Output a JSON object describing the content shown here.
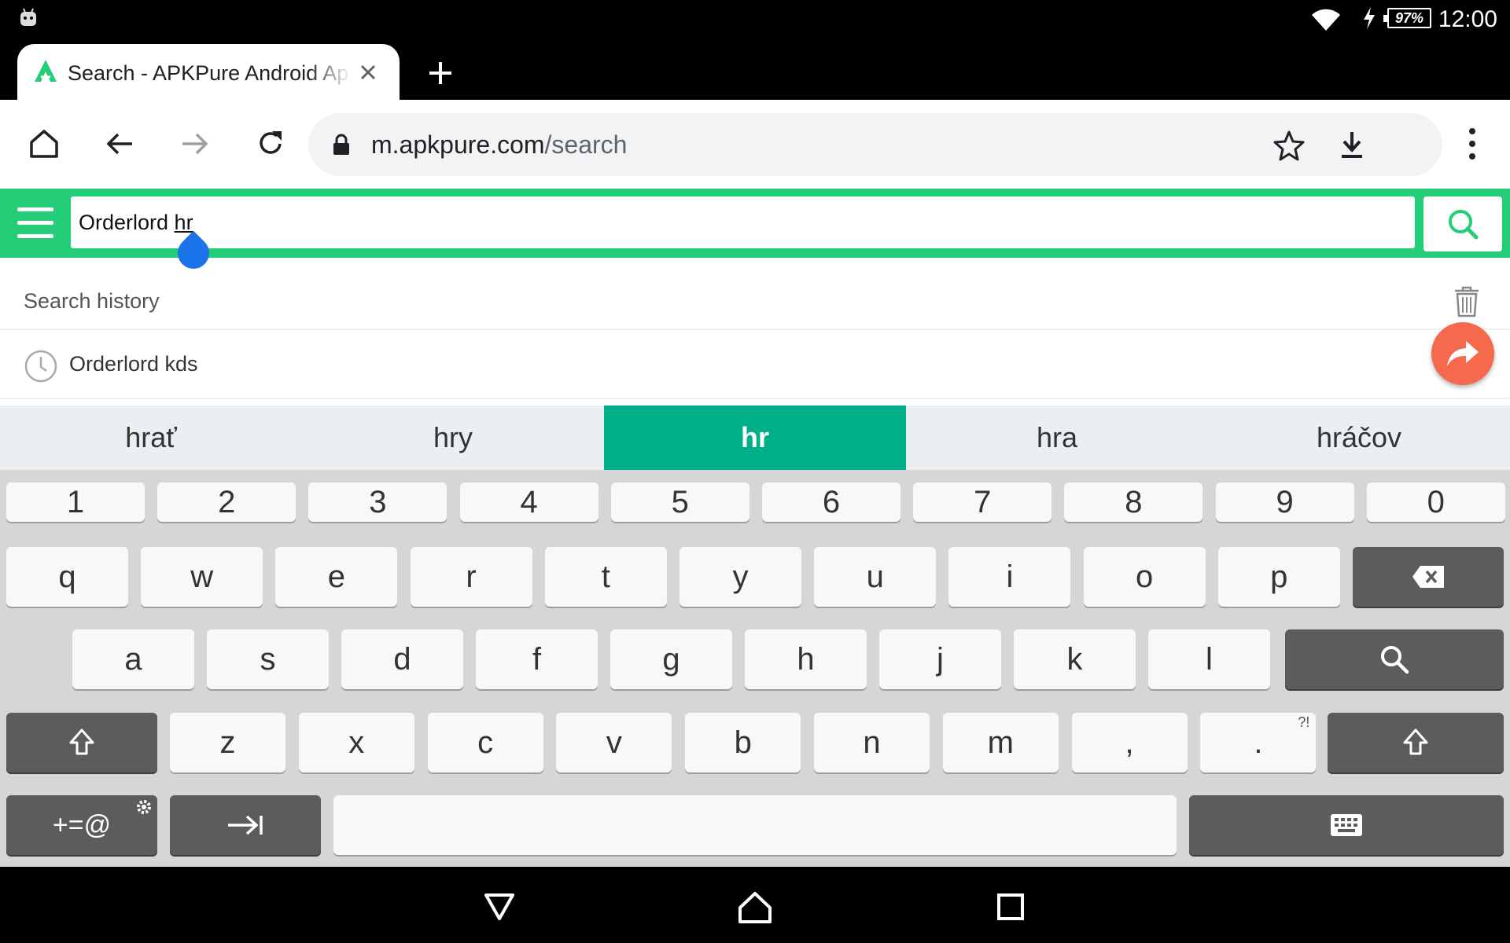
{
  "status_bar": {
    "battery": "97%",
    "time": "12:00"
  },
  "tab": {
    "title": "Search - APKPure Android Apps"
  },
  "toolbar": {
    "url_domain": "m.apkpure.com",
    "url_path": "/search"
  },
  "search": {
    "query_prefix": "Orderlord ",
    "query_composing": "hr"
  },
  "history": {
    "header": "Search history",
    "items": [
      "Orderlord kds"
    ]
  },
  "keyboard": {
    "suggestions": [
      "hrať",
      "hry",
      "hr",
      "hra",
      "hráčov"
    ],
    "active_suggestion": "hr",
    "number_row": [
      "1",
      "2",
      "3",
      "4",
      "5",
      "6",
      "7",
      "8",
      "9",
      "0"
    ],
    "row1": [
      "q",
      "w",
      "e",
      "r",
      "t",
      "y",
      "u",
      "i",
      "o",
      "p"
    ],
    "row2": [
      "a",
      "s",
      "d",
      "f",
      "g",
      "h",
      "j",
      "k",
      "l"
    ],
    "row3": [
      "z",
      "x",
      "c",
      "v",
      "b",
      "n",
      "m",
      ",",
      "."
    ],
    "period_hint": "?!",
    "symbols_label": "+=@"
  },
  "colors": {
    "apkpure_green": "#24cd77",
    "suggestion_active": "#00af8a",
    "fab": "#f56a4c"
  }
}
